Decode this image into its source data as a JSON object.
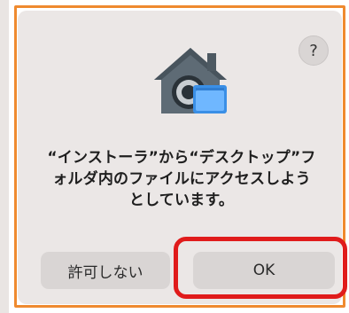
{
  "dialog": {
    "help_label": "?",
    "message_lines": [
      "“インストーラ”から“デスクトップ”フ",
      "ォルダ内のファイルにアクセスしよう",
      "としています。"
    ],
    "buttons": {
      "deny_label": "許可しない",
      "ok_label": "OK"
    },
    "icon": "security-house-lock-icon"
  },
  "colors": {
    "dialog_background": "#ebe7e6",
    "button_background": "#d9d5d4",
    "highlight_red": "#e01b1b",
    "frame_orange": "#ef8a2f"
  }
}
